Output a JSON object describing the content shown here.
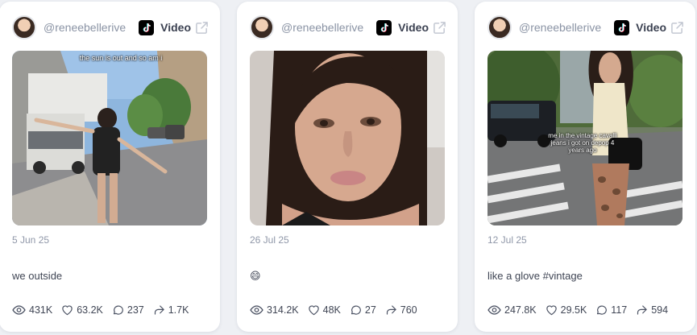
{
  "colors": {
    "page_bg": "#eef0f4",
    "card_bg": "#ffffff",
    "muted_text": "#8a93a4",
    "text": "#3f4554"
  },
  "cards": [
    {
      "handle": "@reneebellerive",
      "platform_icon": "tiktok-icon",
      "type_label": "Video",
      "thumbnail_text": "the sun is out and so am i",
      "date": "5 Jun 25",
      "caption": "we outside",
      "stats": {
        "views": "431K",
        "likes": "63.2K",
        "comments": "237",
        "shares": "1.7K"
      }
    },
    {
      "handle": "@reneebellerive",
      "platform_icon": "tiktok-icon",
      "type_label": "Video",
      "thumbnail_text": "",
      "date": "26 Jul 25",
      "caption": "😄",
      "stats": {
        "views": "314.2K",
        "likes": "48K",
        "comments": "27",
        "shares": "760"
      }
    },
    {
      "handle": "@reneebellerive",
      "platform_icon": "tiktok-icon",
      "type_label": "Video",
      "thumbnail_text": "me in the vintage cavalli jeans i got on depop 4 years ago",
      "date": "12 Jul 25",
      "caption": "like a glove #vintage",
      "stats": {
        "views": "247.8K",
        "likes": "29.5K",
        "comments": "117",
        "shares": "594"
      }
    }
  ]
}
